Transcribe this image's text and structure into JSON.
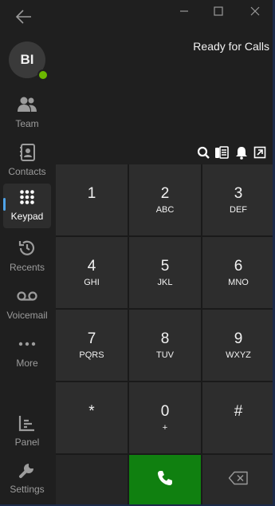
{
  "user": {
    "initials": "BI",
    "presence_color": "#6bb700"
  },
  "nav": [
    {
      "id": "team",
      "label": "Team",
      "icon": "people-icon"
    },
    {
      "id": "contacts",
      "label": "Contacts",
      "icon": "contacts-book-icon"
    },
    {
      "id": "keypad",
      "label": "Keypad",
      "icon": "dialpad-icon",
      "active": true
    },
    {
      "id": "recents",
      "label": "Recents",
      "icon": "history-icon"
    },
    {
      "id": "voicemail",
      "label": "Voicemail",
      "icon": "voicemail-icon"
    },
    {
      "id": "more",
      "label": "More",
      "icon": "ellipsis-icon"
    },
    {
      "id": "panel",
      "label": "Panel",
      "icon": "panel-chart-icon"
    },
    {
      "id": "settings",
      "label": "Settings",
      "icon": "wrench-icon"
    }
  ],
  "status": {
    "text": "Ready for Calls"
  },
  "keys": [
    {
      "digit": "1",
      "letters": ""
    },
    {
      "digit": "2",
      "letters": "ABC"
    },
    {
      "digit": "3",
      "letters": "DEF"
    },
    {
      "digit": "4",
      "letters": "GHI"
    },
    {
      "digit": "5",
      "letters": "JKL"
    },
    {
      "digit": "6",
      "letters": "MNO"
    },
    {
      "digit": "7",
      "letters": "PQRS"
    },
    {
      "digit": "8",
      "letters": "TUV"
    },
    {
      "digit": "9",
      "letters": "WXYZ"
    },
    {
      "digit": "*",
      "letters": ""
    },
    {
      "digit": "0",
      "letters": "+"
    },
    {
      "digit": "#",
      "letters": ""
    }
  ],
  "colors": {
    "accent": "#4fa3e8",
    "call_button": "#108010",
    "presence_available": "#6bb700"
  }
}
